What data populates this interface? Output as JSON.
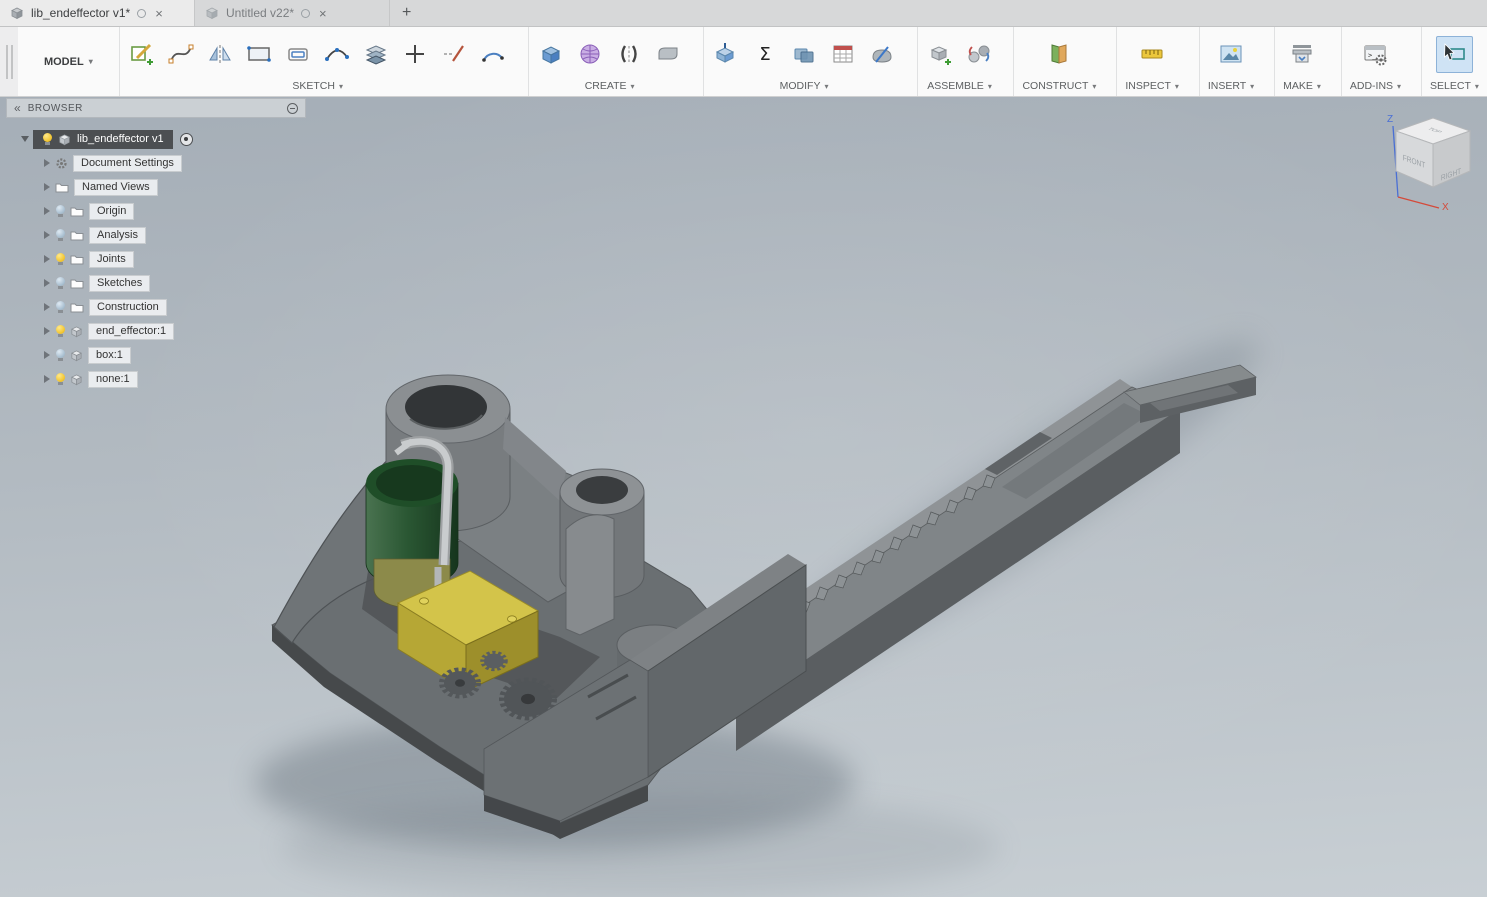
{
  "tabbar": {
    "tabs": [
      {
        "label": "lib_endeffector v1*",
        "active": true
      },
      {
        "label": "Untitled v22*",
        "active": false
      }
    ],
    "new_tab": "+"
  },
  "toolbar": {
    "workspace": "MODEL",
    "groups": [
      {
        "label": "SKETCH",
        "icons": [
          "create-sketch",
          "spline",
          "mirror",
          "two-point-rectangle",
          "offset",
          "fit-point-spline",
          "sketch-pattern",
          "point",
          "trim",
          "arc"
        ]
      },
      {
        "label": "CREATE",
        "icons": [
          "extrude",
          "create-form",
          "pattern-mirror",
          "sweep"
        ]
      },
      {
        "label": "MODIFY",
        "icons": [
          "press-pull",
          "change-parameters",
          "combine",
          "parameters-table",
          "split-body"
        ]
      },
      {
        "label": "ASSEMBLE",
        "icons": [
          "new-component",
          "joint"
        ]
      },
      {
        "label": "CONSTRUCT",
        "icons": [
          "construction-plane"
        ]
      },
      {
        "label": "INSPECT",
        "icons": [
          "measure"
        ]
      },
      {
        "label": "INSERT",
        "icons": [
          "insert-decal"
        ]
      },
      {
        "label": "MAKE",
        "icons": [
          "3d-print"
        ]
      },
      {
        "label": "ADD-INS",
        "icons": [
          "scripts-addins"
        ]
      },
      {
        "label": "SELECT",
        "icons": [
          "select-cursor"
        ]
      }
    ]
  },
  "browser": {
    "title": "BROWSER",
    "root": {
      "label": "lib_endeffector v1",
      "bulb": "on"
    },
    "items": [
      {
        "label": "Document Settings",
        "icon": "gear",
        "bulb": "none"
      },
      {
        "label": "Named Views",
        "icon": "folder",
        "bulb": "none"
      },
      {
        "label": "Origin",
        "icon": "folder",
        "bulb": "off"
      },
      {
        "label": "Analysis",
        "icon": "folder",
        "bulb": "off"
      },
      {
        "label": "Joints",
        "icon": "folder",
        "bulb": "on"
      },
      {
        "label": "Sketches",
        "icon": "folder",
        "bulb": "off"
      },
      {
        "label": "Construction",
        "icon": "folder",
        "bulb": "off"
      },
      {
        "label": "end_effector:1",
        "icon": "component",
        "bulb": "on"
      },
      {
        "label": "box:1",
        "icon": "component",
        "bulb": "off"
      },
      {
        "label": "none:1",
        "icon": "component",
        "bulb": "on"
      }
    ]
  },
  "viewcube": {
    "top": "TOP",
    "front": "FRONT",
    "right": "RIGHT",
    "axis_z": "Z",
    "axis_x": "X"
  },
  "colors": {
    "accent_select": "#cfe3f5",
    "bulb_on": "#f2c531",
    "bulb_off": "#a9bfd0",
    "canvas_top": "#a5aeb7",
    "canvas_bottom": "#c8cfd4"
  }
}
